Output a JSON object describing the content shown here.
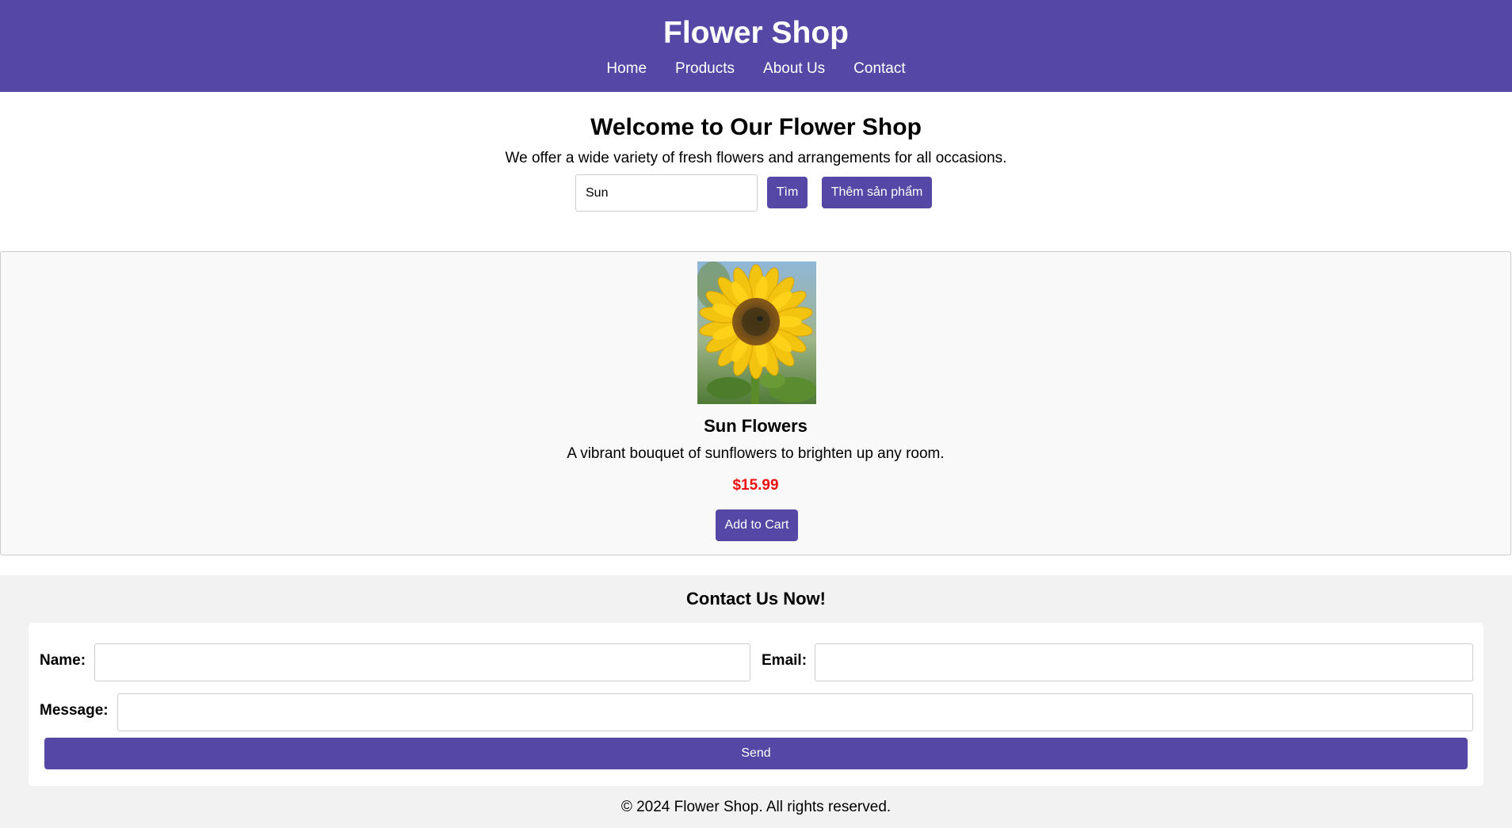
{
  "header": {
    "title": "Flower Shop",
    "nav": [
      "Home",
      "Products",
      "About Us",
      "Contact"
    ]
  },
  "intro": {
    "heading": "Welcome to Our Flower Shop",
    "text": "We offer a wide variety of fresh flowers and arrangements for all occasions.",
    "search_value": "Sun",
    "search_button": "Tìm",
    "add_product_button": "Thêm sản phẩm"
  },
  "product": {
    "name": "Sun Flowers",
    "description": "A vibrant bouquet of sunflowers to brighten up any room.",
    "price": "$15.99",
    "add_to_cart": "Add to Cart"
  },
  "contact": {
    "heading": "Contact Us Now!",
    "name_label": "Name:",
    "email_label": "Email:",
    "message_label": "Message:",
    "send_button": "Send"
  },
  "footer": {
    "text": "© 2024 Flower Shop. All rights reserved."
  },
  "colors": {
    "brand": "#5447a6",
    "price": "#ee1111",
    "product_bg": "#f9f9f9",
    "contact_bg": "#f2f2f2"
  }
}
